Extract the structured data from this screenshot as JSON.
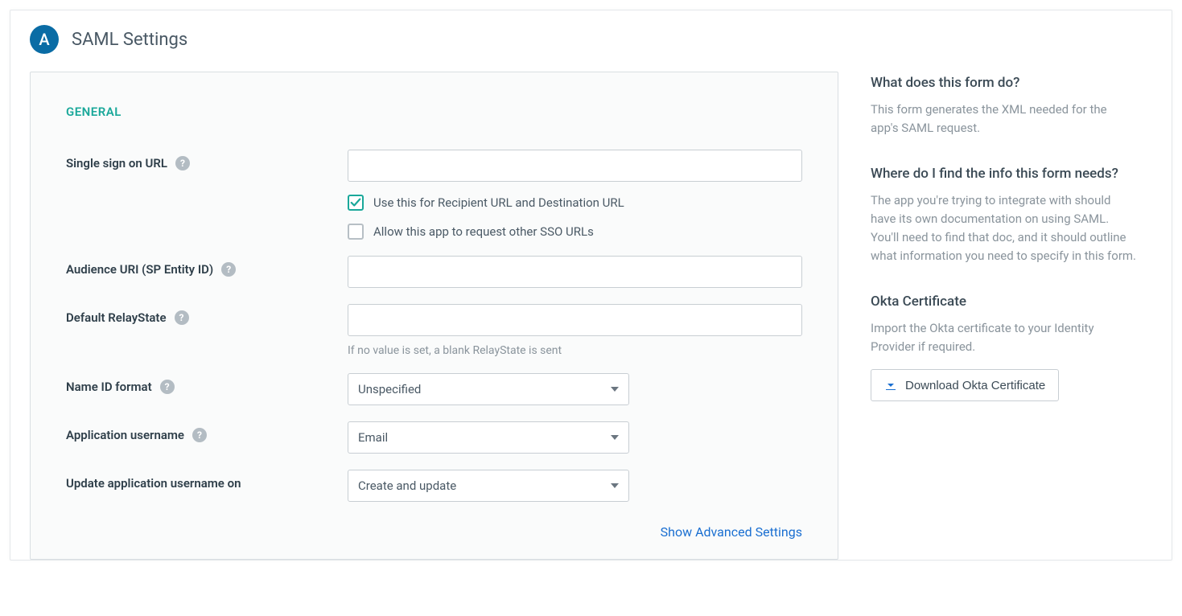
{
  "header": {
    "avatar_letter": "A",
    "title": "SAML Settings"
  },
  "form": {
    "section_heading": "GENERAL",
    "sso_url": {
      "label": "Single sign on URL",
      "value": "",
      "checkbox_recipient": {
        "checked": true,
        "label": "Use this for Recipient URL and Destination URL"
      },
      "checkbox_other_sso": {
        "checked": false,
        "label": "Allow this app to request other SSO URLs"
      }
    },
    "audience_uri": {
      "label": "Audience URI (SP Entity ID)",
      "value": ""
    },
    "relay_state": {
      "label": "Default RelayState",
      "value": "",
      "hint": "If no value is set, a blank RelayState is sent"
    },
    "name_id_format": {
      "label": "Name ID format",
      "value": "Unspecified"
    },
    "app_username": {
      "label": "Application username",
      "value": "Email"
    },
    "update_username_on": {
      "label": "Update application username on",
      "value": "Create and update"
    },
    "advanced_link": "Show Advanced Settings"
  },
  "sidebar": {
    "what": {
      "title": "What does this form do?",
      "text": "This form generates the XML needed for the app's SAML request."
    },
    "where": {
      "title": "Where do I find the info this form needs?",
      "text": "The app you're trying to integrate with should have its own documentation on using SAML. You'll need to find that doc, and it should outline what information you need to specify in this form."
    },
    "cert": {
      "title": "Okta Certificate",
      "text": "Import the Okta certificate to your Identity Provider if required.",
      "button": "Download Okta Certificate"
    }
  }
}
